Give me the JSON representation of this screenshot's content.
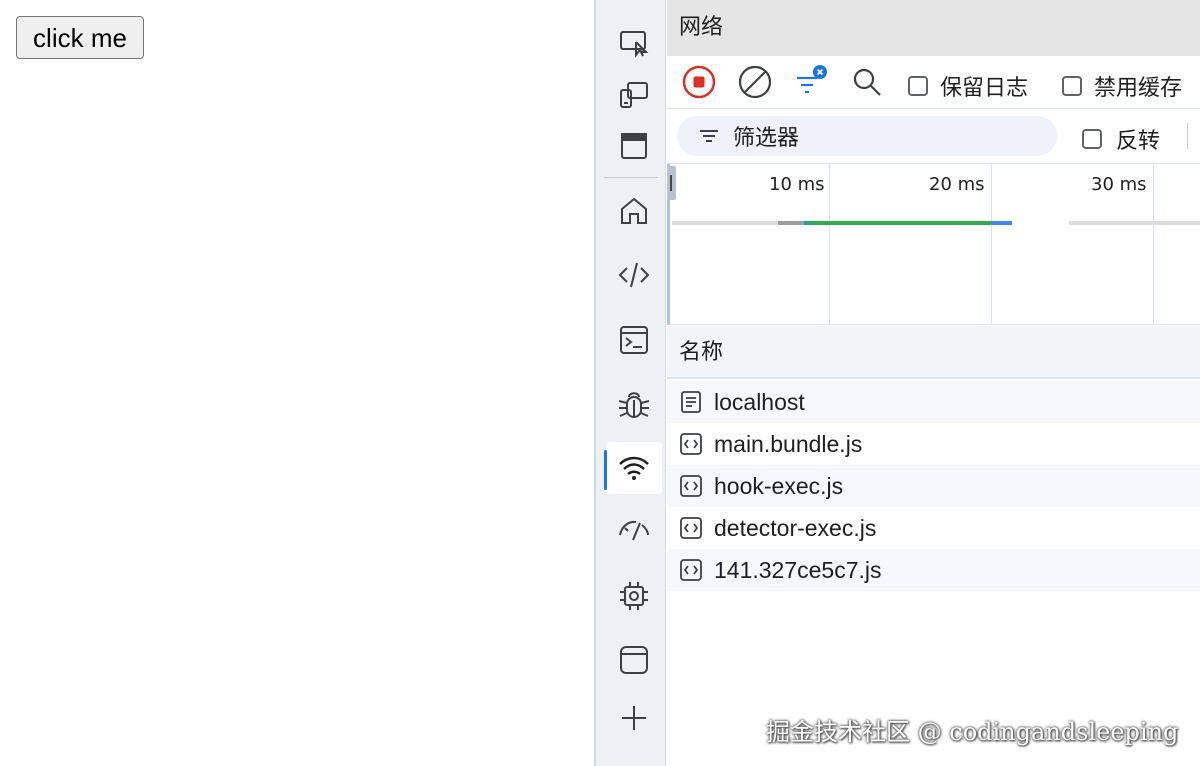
{
  "page": {
    "button_label": "click me"
  },
  "activity_bar": {
    "items": [
      {
        "icon": "inspect-element-icon"
      },
      {
        "icon": "device-emulation-icon"
      },
      {
        "icon": "window-icon"
      },
      {
        "icon": "home-icon"
      },
      {
        "icon": "code-elements-icon"
      },
      {
        "icon": "console-icon"
      },
      {
        "icon": "debugger-bug-icon"
      },
      {
        "icon": "network-wifi-icon",
        "active": true
      },
      {
        "icon": "performance-gauge-icon"
      },
      {
        "icon": "memory-chip-icon"
      },
      {
        "icon": "application-icon"
      },
      {
        "icon": "add-tool-icon"
      }
    ]
  },
  "network": {
    "title": "网络",
    "toolbar": {
      "preserve_log_label": "保留日志",
      "disable_cache_label": "禁用缓存"
    },
    "filter": {
      "placeholder": "筛选器",
      "invert_label": "反转"
    },
    "timeline": {
      "ticks": [
        "10 ms",
        "20 ms",
        "30 ms"
      ]
    },
    "table": {
      "name_header": "名称",
      "rows": [
        {
          "name": "localhost",
          "type": "document"
        },
        {
          "name": "main.bundle.js",
          "type": "script"
        },
        {
          "name": "hook-exec.js",
          "type": "script"
        },
        {
          "name": "detector-exec.js",
          "type": "script"
        },
        {
          "name": "141.327ce5c7.js",
          "type": "script"
        }
      ]
    }
  },
  "watermark": "掘金技术社区 @ codingandsleeping",
  "colors": {
    "accent": "#1a73e8",
    "record_red": "#d93025",
    "bar_green": "#34a853",
    "bar_blue": "#4285f4",
    "bar_gray": "#9e9e9e"
  }
}
